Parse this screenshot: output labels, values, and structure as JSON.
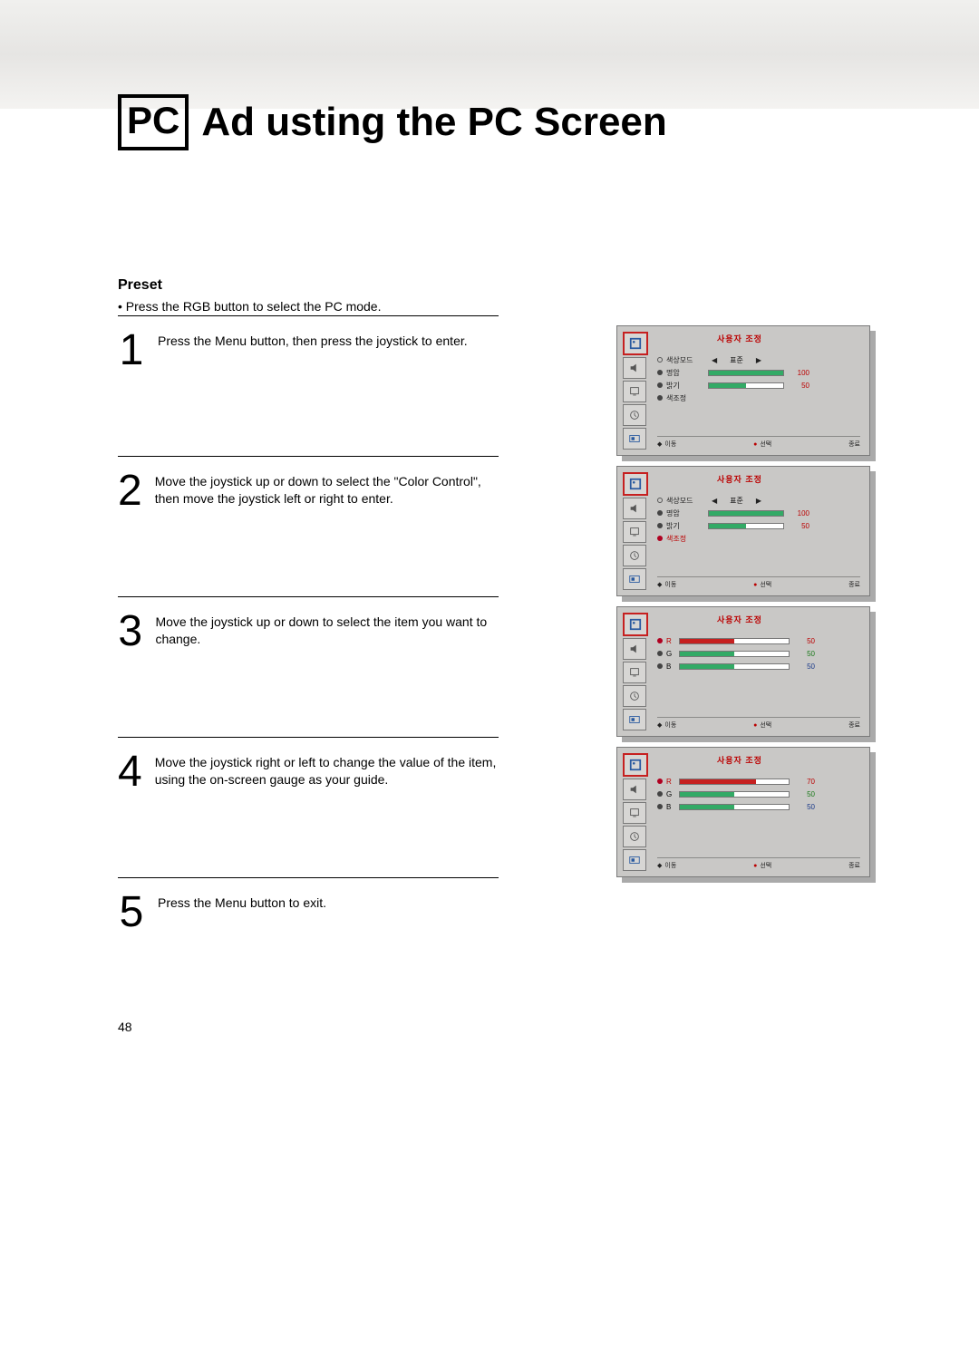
{
  "header": {
    "badge": "PC",
    "title": "Ad usting the PC Screen"
  },
  "section_title": "Preset",
  "intro": "•  Press the RGB button to select the PC mode.",
  "steps": {
    "s1": {
      "num": "1",
      "text": "Press the Menu button, then press the joystick to enter."
    },
    "s2": {
      "num": "2",
      "text": "Move the joystick up or down to select the \"Color Control\", then move the joystick left or right to enter."
    },
    "s3": {
      "num": "3",
      "text": "Move the joystick up or down to select the item you want to change."
    },
    "s4": {
      "num": "4",
      "text": "Move the joystick right or left to change the value of the item, using the on-screen gauge as your guide."
    },
    "s5": {
      "num": "5",
      "text": "Press the Menu button to exit."
    }
  },
  "osd_common": {
    "header_title": "사용자 조정",
    "footer": {
      "move": "이동",
      "select": "선택",
      "exit": "종료"
    }
  },
  "osd1": {
    "mode_label": "색상모드",
    "mode_value": "표준",
    "rows": [
      {
        "label": "명암",
        "value": 100,
        "value_text": "100",
        "color": "red"
      },
      {
        "label": "밝기",
        "value": 50,
        "value_text": "50",
        "color": "red"
      },
      {
        "label": "색조정",
        "value": null
      }
    ]
  },
  "osd2": {
    "mode_label": "색상모드",
    "mode_value": "표준",
    "rows": [
      {
        "label": "명암",
        "value": 100,
        "value_text": "100",
        "color": "red"
      },
      {
        "label": "밝기",
        "value": 50,
        "value_text": "50",
        "color": "red"
      },
      {
        "label": "색조정",
        "value": null,
        "selected": true
      }
    ]
  },
  "osd3": {
    "rows": [
      {
        "label": "R",
        "value": 50,
        "value_text": "50",
        "bar_color": "red",
        "num_color": "red",
        "selected": true
      },
      {
        "label": "G",
        "value": 50,
        "value_text": "50",
        "bar_color": "green",
        "num_color": "green"
      },
      {
        "label": "B",
        "value": 50,
        "value_text": "50",
        "bar_color": "green",
        "num_color": "blue"
      }
    ]
  },
  "osd4": {
    "rows": [
      {
        "label": "R",
        "value": 70,
        "value_text": "70",
        "bar_color": "red",
        "num_color": "red",
        "selected": true
      },
      {
        "label": "G",
        "value": 50,
        "value_text": "50",
        "bar_color": "green",
        "num_color": "green"
      },
      {
        "label": "B",
        "value": 50,
        "value_text": "50",
        "bar_color": "green",
        "num_color": "blue"
      }
    ]
  },
  "page_number": "48"
}
